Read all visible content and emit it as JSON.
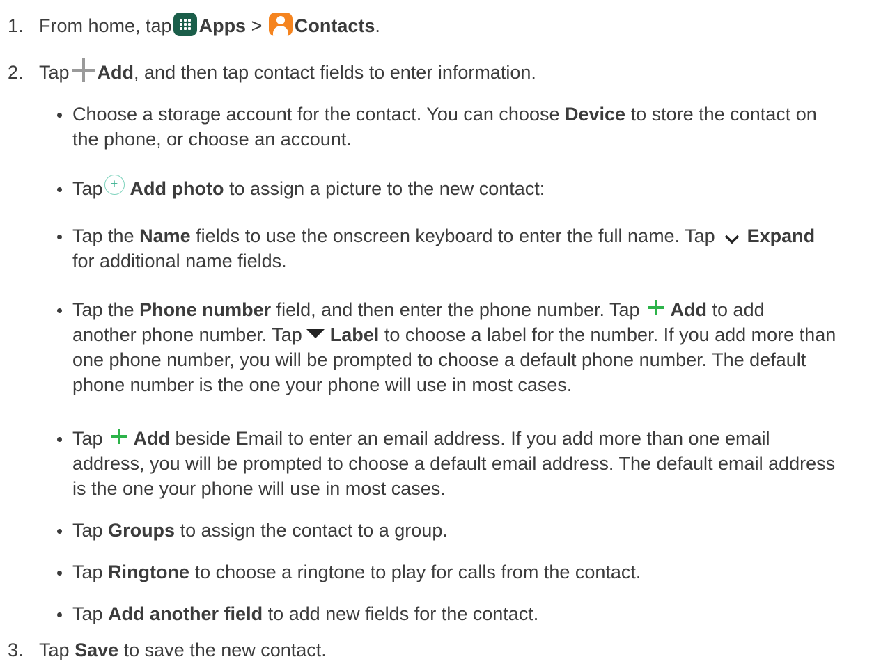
{
  "step1": {
    "num": "1.",
    "t1": "From home, tap",
    "b1": "Apps",
    "t2": ">",
    "b2": "Contacts",
    "t3": "."
  },
  "step2": {
    "num": "2.",
    "t1": "Tap",
    "b1": "Add",
    "t2": ", and then tap contact fields to enter information."
  },
  "bullets": {
    "storage": {
      "l1a": "Choose a storage account for the contact. You can choose",
      "l1b": "Device",
      "l1c": "to store the contact on",
      "l2": "the phone, or choose an account."
    },
    "photo": {
      "t1": "Tap",
      "b1": "Add photo",
      "t2": "to assign a picture to the new contact:"
    },
    "name": {
      "l1a": "Tap the",
      "l1b": "Name",
      "l1c": "fields to use the onscreen keyboard to enter the full name. Tap",
      "l1d": "Expand",
      "l2": "for additional name fields."
    },
    "phone": {
      "l1a": "Tap the",
      "l1b": "Phone number",
      "l1c": "field, and then enter the phone number. Tap",
      "l1d": "Add",
      "l1e": "to add",
      "l2a": "another phone number. Tap",
      "l2b": "Label",
      "l2c": "to choose a label for the number. If you add more than",
      "l3": "one phone number, you will be prompted to choose a default phone number. The default",
      "l4": "phone number is the one your phone will use in most cases."
    },
    "email": {
      "l1a": "Tap",
      "l1b": "Add",
      "l1c": "beside Email to enter an email address. If you add more than one email",
      "l2": "address, you will be prompted to choose a default email address. The default email address",
      "l3": "is the one your phone will use in most cases."
    },
    "groups": {
      "t1": "Tap",
      "b1": "Groups",
      "t2": "to assign the contact to a group."
    },
    "ringtone": {
      "t1": "Tap",
      "b1": "Ringtone",
      "t2": "to choose a ringtone to play for calls from the contact."
    },
    "another": {
      "t1": "Tap",
      "b1": "Add another field",
      "t2": " to add new fields for the contact."
    }
  },
  "step3": {
    "num": "3.",
    "t1": "Tap",
    "b1": "Save",
    "t2": "to save the new contact."
  },
  "icons": {
    "apps": "apps-grid-icon",
    "contacts": "contacts-person-icon",
    "add": "plus-icon",
    "add_photo": "circle-plus-icon",
    "expand": "chevron-down-icon",
    "label": "triangle-down-icon",
    "circle_plus_glyph": "+"
  },
  "colors": {
    "text": "#3c3c3c",
    "apps_icon": "#1b5e4a",
    "contacts_icon": "#f5841f",
    "add_green": "#2db34a",
    "add_photo_teal": "#38b08f"
  }
}
